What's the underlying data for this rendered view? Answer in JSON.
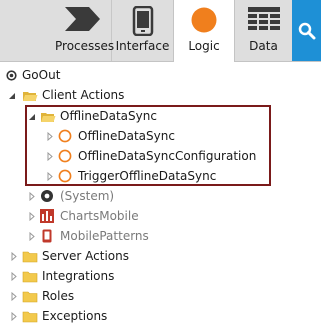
{
  "tabs": [
    {
      "label": "Processes",
      "icon": "processes-icon"
    },
    {
      "label": "Interface",
      "icon": "phone-icon"
    },
    {
      "label": "Logic",
      "icon": "logic-circle-icon",
      "active": true
    },
    {
      "label": "Data",
      "icon": "data-grid-icon"
    }
  ],
  "search": {
    "icon": "search-icon"
  },
  "colors": {
    "accent_orange": "#f07f1d",
    "search_blue": "#1e90d6",
    "folder_yellow": "#f2c94c",
    "highlight_border": "#7a1a1a",
    "tab_bar_bg": "#dedede"
  },
  "tree": {
    "root": "GoOut",
    "client_actions": "Client Actions",
    "offline_folder": "OfflineDataSync",
    "offline_items": [
      "OfflineDataSync",
      "OfflineDataSyncConfiguration",
      "TriggerOfflineDataSync"
    ],
    "system": "(System)",
    "charts_mobile": "ChartsMobile",
    "mobile_patterns": "MobilePatterns",
    "folders": [
      "Server Actions",
      "Integrations",
      "Roles",
      "Exceptions"
    ]
  }
}
